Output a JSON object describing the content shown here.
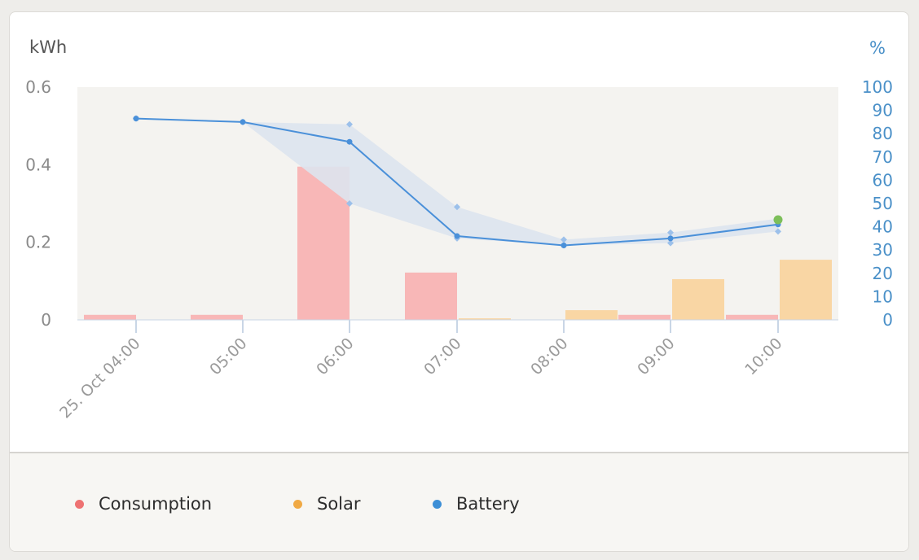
{
  "chart_data": {
    "type": "bar",
    "left_axis": {
      "title": "kWh",
      "ticks": [
        "0.6",
        "0.4",
        "0.2",
        "0"
      ],
      "tick_values": [
        0.6,
        0.4,
        0.2,
        0
      ],
      "ylim": [
        0,
        0.6
      ]
    },
    "right_axis": {
      "title": "%",
      "ticks": [
        "100",
        "90",
        "80",
        "70",
        "60",
        "50",
        "40",
        "30",
        "20",
        "10",
        "0"
      ],
      "tick_values": [
        100,
        90,
        80,
        70,
        60,
        50,
        40,
        30,
        20,
        10,
        0
      ],
      "ylim": [
        0,
        100
      ]
    },
    "x_labels": [
      "25. Oct 04:00",
      "05:00",
      "06:00",
      "07:00",
      "08:00",
      "09:00",
      "10:00"
    ],
    "series": [
      {
        "name": "Consumption",
        "axis": "left",
        "kind": "bar",
        "color": "#f8b7b7",
        "values": [
          0.013,
          0.013,
          0.395,
          0.122,
          0,
          0.013,
          0.013
        ]
      },
      {
        "name": "Solar",
        "axis": "left",
        "kind": "bar",
        "color": "#f9d6a4",
        "values": [
          0,
          0,
          0,
          0.004,
          0.025,
          0.105,
          0.155
        ]
      },
      {
        "name": "Battery",
        "axis": "right",
        "kind": "line",
        "color": "#4a90d9",
        "band_color": "#dde4ee",
        "values": [
          86.5,
          85,
          76.5,
          36,
          32,
          35,
          41
        ],
        "band_max": [
          86.5,
          85,
          84,
          48.5,
          34.5,
          37.5,
          43.5
        ],
        "band_min": [
          86.5,
          85,
          50,
          35,
          32,
          33,
          38
        ],
        "current_marker_color": "#7dbf5a",
        "current_value": 43
      }
    ]
  },
  "legend": {
    "items": [
      {
        "label": "Consumption",
        "color": "#ee7272"
      },
      {
        "label": "Solar",
        "color": "#f0a944"
      },
      {
        "label": "Battery",
        "color": "#3d8fd6"
      }
    ]
  }
}
